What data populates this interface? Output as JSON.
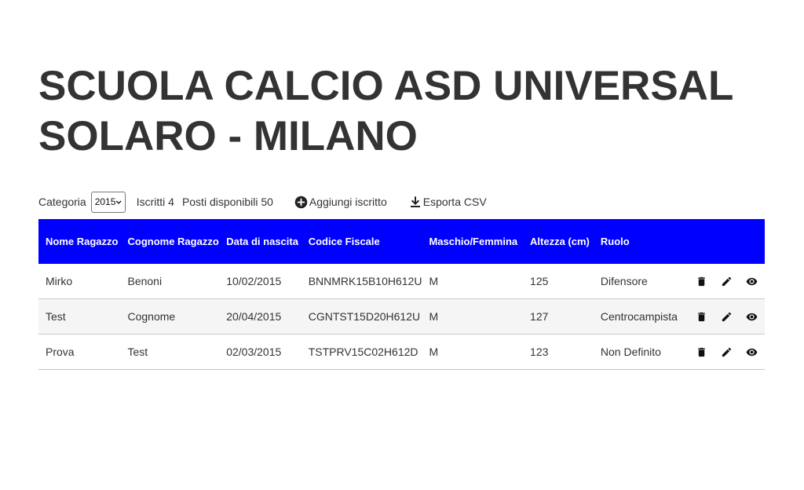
{
  "page": {
    "title": "SCUOLA CALCIO ASD UNIVERSAL SOLARO - MILANO"
  },
  "toolbar": {
    "category_label": "Categoria",
    "category_value": "2015",
    "enrolled_text": "Iscritti 4",
    "available_text": "Posti disponibili 50",
    "add_label": "Aggiungi iscritto",
    "export_label": "Esporta CSV"
  },
  "table": {
    "headers": {
      "name": "Nome Ragazzo",
      "surname": "Cognome Ragazzo",
      "birth": "Data di nascita",
      "tax_code": "Codice Fiscale",
      "gender": "Maschio/Femmina",
      "height": "Altezza (cm)",
      "role": "Ruolo"
    },
    "rows": [
      {
        "name": "Mirko",
        "surname": "Benoni",
        "birth": "10/02/2015",
        "tax_code": "BNNMRK15B10H612U",
        "gender": "M",
        "height": "125",
        "role": "Difensore"
      },
      {
        "name": "Test",
        "surname": "Cognome",
        "birth": "20/04/2015",
        "tax_code": "CGNTST15D20H612U",
        "gender": "M",
        "height": "127",
        "role": "Centrocampista"
      },
      {
        "name": "Prova",
        "surname": "Test",
        "birth": "02/03/2015",
        "tax_code": "TSTPRV15C02H612D",
        "gender": "M",
        "height": "123",
        "role": "Non Definito"
      }
    ]
  },
  "icons": {
    "delete": "trash-icon",
    "edit": "pencil-icon",
    "view": "eye-icon",
    "add": "plus-circle-icon",
    "export": "download-icon",
    "select": "chevron-down-icon"
  },
  "colors": {
    "header_bg": "#0000ff",
    "header_text": "#ffffff",
    "text": "#333333"
  }
}
